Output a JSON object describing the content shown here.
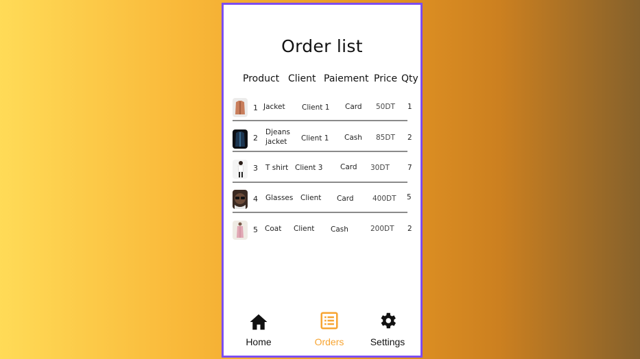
{
  "app": {
    "title": "Order list"
  },
  "table": {
    "columns": [
      "Product",
      "Client",
      "Paiement",
      "Price",
      "Qty"
    ],
    "rows": [
      {
        "index": "1",
        "product": "Jacket",
        "client": "Client 1",
        "payment": "Card",
        "price": "50DT",
        "qty": "1",
        "thumb_color": "#c87d5b"
      },
      {
        "index": "2",
        "product": "Djeans jacket",
        "product_line1": "Djeans",
        "product_line2": "jacket",
        "client": "Client 1",
        "payment": "Cash",
        "price": "85DT",
        "qty": "2",
        "thumb_color": "#1c3550"
      },
      {
        "index": "3",
        "product": "T shirt",
        "client": "Client 3",
        "payment": "Card",
        "price": "30DT",
        "qty": "7",
        "thumb_color": "#e5e5e5"
      },
      {
        "index": "4",
        "product": "Glasses",
        "client": "Client",
        "payment": "Card",
        "price": "400DT",
        "qty": "5",
        "thumb_color": "#3a2a22"
      },
      {
        "index": "5",
        "product": "Coat",
        "client": "Client",
        "payment": "Cash",
        "price": "200DT",
        "qty": "2",
        "thumb_color": "#e1a7b4"
      }
    ]
  },
  "nav": {
    "items": [
      {
        "label": "Home",
        "icon": "home-icon",
        "active": false
      },
      {
        "label": "Orders",
        "icon": "list-icon",
        "active": true
      },
      {
        "label": "Settings",
        "icon": "gear-icon",
        "active": false
      }
    ]
  },
  "colors": {
    "accent": "#f7a431",
    "frame": "#7c4df1"
  }
}
